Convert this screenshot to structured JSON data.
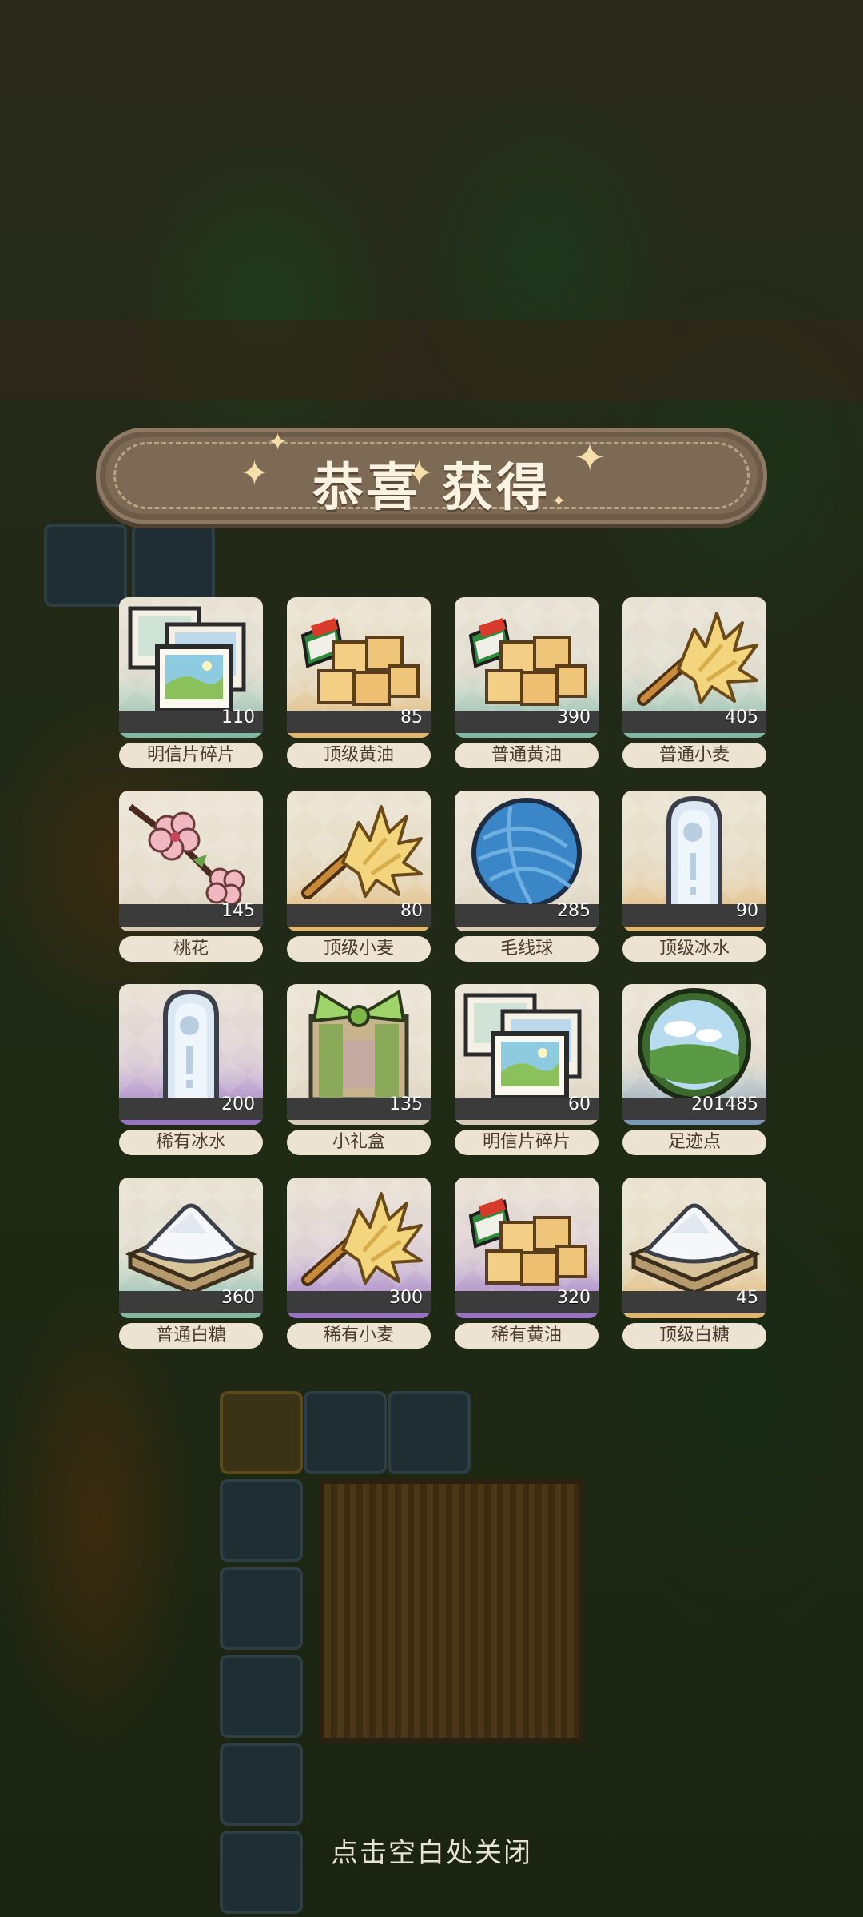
{
  "banner": {
    "title": "恭喜 获得"
  },
  "rewards": [
    {
      "name": "明信片碎片",
      "count": "110",
      "icon": "postcard-icon",
      "rarity": "normal"
    },
    {
      "name": "顶级黄油",
      "count": "85",
      "icon": "butter-icon",
      "rarity": "top"
    },
    {
      "name": "普通黄油",
      "count": "390",
      "icon": "butter-icon",
      "rarity": "normal"
    },
    {
      "name": "普通小麦",
      "count": "405",
      "icon": "wheat-icon",
      "rarity": "normal"
    },
    {
      "name": "桃花",
      "count": "145",
      "icon": "peach-blossom-icon",
      "rarity": "neutral"
    },
    {
      "name": "顶级小麦",
      "count": "80",
      "icon": "wheat-icon",
      "rarity": "top"
    },
    {
      "name": "毛线球",
      "count": "285",
      "icon": "yarn-ball-icon",
      "rarity": "neutral"
    },
    {
      "name": "顶级冰水",
      "count": "90",
      "icon": "ice-water-icon",
      "rarity": "top"
    },
    {
      "name": "稀有冰水",
      "count": "200",
      "icon": "ice-water-icon",
      "rarity": "rare"
    },
    {
      "name": "小礼盒",
      "count": "135",
      "icon": "gift-box-icon",
      "rarity": "neutral"
    },
    {
      "name": "明信片碎片",
      "count": "60",
      "icon": "postcard-icon",
      "rarity": "neutral"
    },
    {
      "name": "足迹点",
      "count": "201485",
      "icon": "footprint-orb-icon",
      "rarity": "blue"
    },
    {
      "name": "普通白糖",
      "count": "360",
      "icon": "sugar-icon",
      "rarity": "normal"
    },
    {
      "name": "稀有小麦",
      "count": "300",
      "icon": "wheat-icon",
      "rarity": "rare"
    },
    {
      "name": "稀有黄油",
      "count": "320",
      "icon": "butter-icon",
      "rarity": "rare"
    },
    {
      "name": "顶级白糖",
      "count": "45",
      "icon": "sugar-icon",
      "rarity": "top"
    }
  ],
  "rarity_colors": {
    "normal": "#7fb8a3",
    "top": "#e1b76c",
    "rare": "#9a71c9",
    "neutral": "#d7ccb9",
    "blue": "#7a98b8"
  },
  "hint": {
    "text": "点击空白处关闭"
  }
}
